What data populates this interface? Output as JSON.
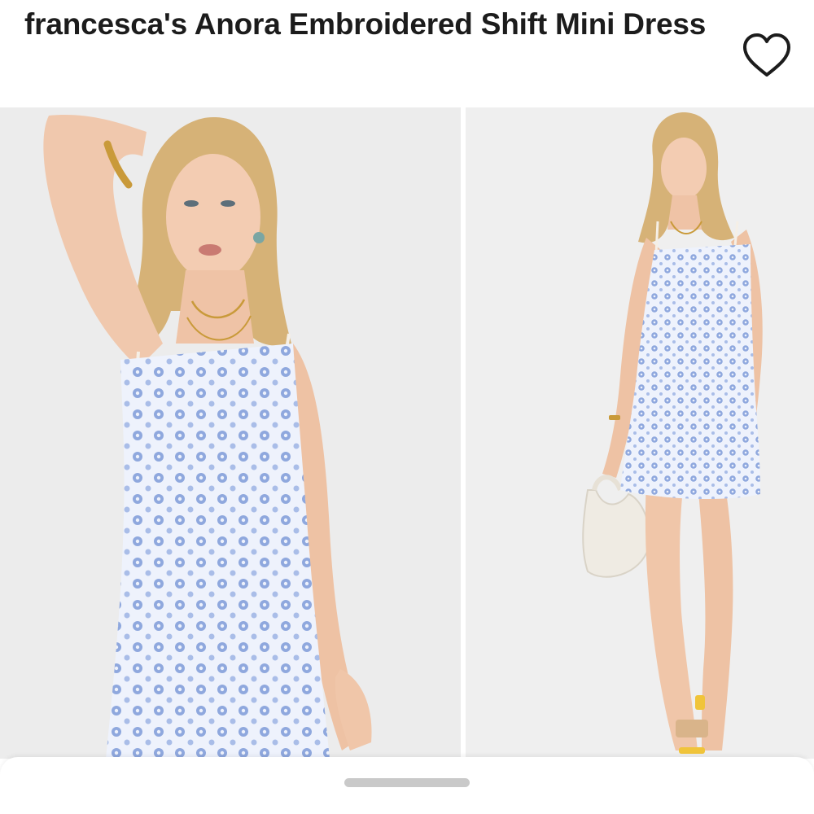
{
  "product": {
    "brand": "francesca's",
    "name": "Anora Embroidered Shift Mini Dress"
  },
  "favorite": {
    "icon": "heart-outline-icon",
    "state": "not-favorited"
  },
  "gallery": {
    "images": [
      {
        "alt": "Model in blue embroidered mini dress, close-up, arm raised",
        "icon": "product-photo"
      },
      {
        "alt": "Model in blue embroidered mini dress, full length with white handbag",
        "icon": "product-photo"
      }
    ]
  },
  "colors": {
    "text": "#1c1c1c",
    "background": "#ffffff",
    "photo_background": "#ececec",
    "dress_base": "#e9eefb",
    "dress_pattern": "#7f9bd6",
    "handle": "#c9c9c9"
  }
}
